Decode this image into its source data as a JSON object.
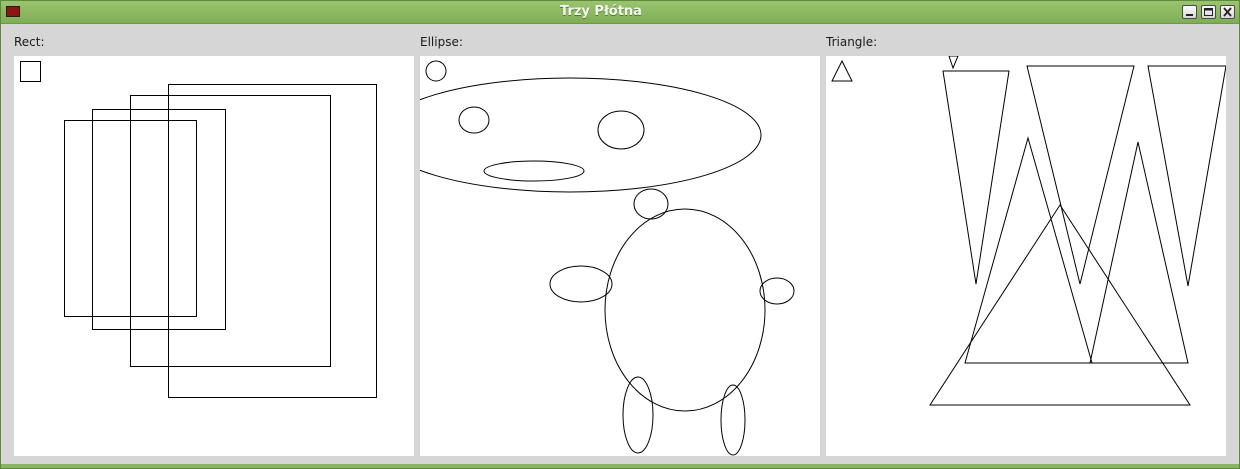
{
  "window": {
    "title": "Trzy Płótna",
    "controls": [
      "minimize-icon",
      "maximize-icon",
      "close-icon"
    ]
  },
  "panels": [
    {
      "label": "Rect:",
      "shape": "rect"
    },
    {
      "label": "Ellipse:",
      "shape": "ellipse"
    },
    {
      "label": "Triangle:",
      "shape": "triangle"
    }
  ],
  "colors": {
    "titlebar": "#8bb464",
    "canvas_background": "#ffffff",
    "stroke": "#000000"
  }
}
